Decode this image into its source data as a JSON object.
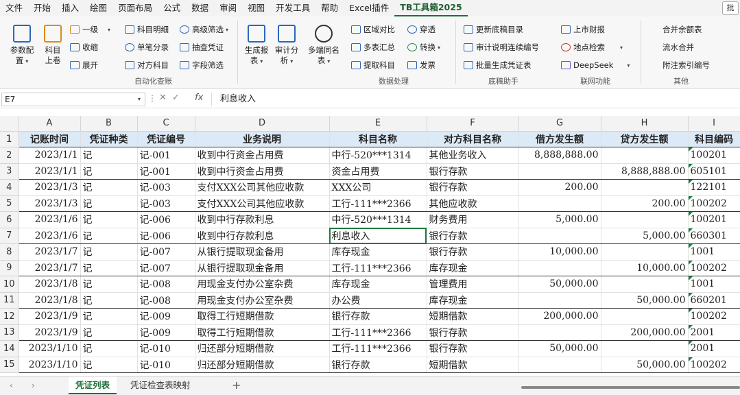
{
  "menu": [
    "文件",
    "开始",
    "插入",
    "绘图",
    "页面布局",
    "公式",
    "数据",
    "审阅",
    "视图",
    "开发工具",
    "帮助",
    "Excel插件",
    "TB工具箱2025"
  ],
  "menu_end": "批",
  "ribbon": {
    "g1": {
      "big1": "参数配置",
      "big2": "科目上卷",
      "small": [
        "一级",
        "收缩",
        "展开",
        "科目明细",
        "单笔分录",
        "对方科目",
        "高级筛选",
        "抽查凭证",
        "字段筛选"
      ],
      "label": "自动化查账"
    },
    "g2": {
      "big1": "生成报表",
      "big2": "审计分析",
      "big3": "多端同名表",
      "small": [
        "区域对比",
        "多表汇总",
        "提取科目",
        "穿透",
        "转换",
        "发票"
      ],
      "label": "数据处理"
    },
    "g3": {
      "small": [
        "更新底稿目录",
        "审计说明连续编号",
        "批量生成凭证表",
        "上市财报",
        "地点检索",
        "DeepSeek"
      ],
      "label": "底稿助手",
      "label2": "联网功能"
    },
    "g4": {
      "small": [
        "合并余额表",
        "流水合并",
        "附注索引编号"
      ],
      "label": "其他"
    }
  },
  "formula": {
    "cell": "E7",
    "value": "利息收入"
  },
  "columns": [
    "A",
    "B",
    "C",
    "D",
    "E",
    "F",
    "G",
    "H",
    "I"
  ],
  "header_row": [
    "记账时间",
    "凭证种类",
    "凭证编号",
    "业务说明",
    "科目名称",
    "对方科目名称",
    "借方发生额",
    "贷方发生额",
    "科目编码"
  ],
  "rows": [
    [
      "2023/1/1",
      "记",
      "记-001",
      "收到中行资金占用费",
      "中行-520***1314",
      "其他业务收入",
      "8,888,888.00",
      "",
      "100201"
    ],
    [
      "2023/1/1",
      "记",
      "记-001",
      "收到中行资金占用费",
      "资金占用费",
      "银行存款",
      "",
      "8,888,888.00",
      "605101"
    ],
    [
      "2023/1/3",
      "记",
      "记-003",
      "支付XXX公司其他应收款",
      "XXX公司",
      "银行存款",
      "200.00",
      "",
      "122101"
    ],
    [
      "2023/1/3",
      "记",
      "记-003",
      "支付XXX公司其他应收款",
      "工行-111***2366",
      "其他应收款",
      "",
      "200.00",
      "100202"
    ],
    [
      "2023/1/6",
      "记",
      "记-006",
      "收到中行存款利息",
      "中行-520***1314",
      "财务费用",
      "5,000.00",
      "",
      "100201"
    ],
    [
      "2023/1/6",
      "记",
      "记-006",
      "收到中行存款利息",
      "利息收入",
      "银行存款",
      "",
      "5,000.00",
      "660301"
    ],
    [
      "2023/1/7",
      "记",
      "记-007",
      "从银行提取现金备用",
      "库存现金",
      "银行存款",
      "10,000.00",
      "",
      "1001"
    ],
    [
      "2023/1/7",
      "记",
      "记-007",
      "从银行提取现金备用",
      "工行-111***2366",
      "库存现金",
      "",
      "10,000.00",
      "100202"
    ],
    [
      "2023/1/8",
      "记",
      "记-008",
      "用现金支付办公室杂费",
      "库存现金",
      "管理费用",
      "50,000.00",
      "",
      "1001"
    ],
    [
      "2023/1/8",
      "记",
      "记-008",
      "用现金支付办公室杂费",
      "办公费",
      "库存现金",
      "",
      "50,000.00",
      "660201"
    ],
    [
      "2023/1/9",
      "记",
      "记-009",
      "取得工行短期借款",
      "银行存款",
      "短期借款",
      "200,000.00",
      "",
      "100202"
    ],
    [
      "2023/1/9",
      "记",
      "记-009",
      "取得工行短期借款",
      "工行-111***2366",
      "银行存款",
      "",
      "200,000.00",
      "2001"
    ],
    [
      "2023/1/10",
      "记",
      "记-010",
      "归还部分短期借款",
      "工行-111***2366",
      "银行存款",
      "50,000.00",
      "",
      "2001"
    ],
    [
      "2023/1/10",
      "记",
      "记-010",
      "归还部分短期借款",
      "银行存款",
      "短期借款",
      "",
      "50,000.00",
      "100202"
    ]
  ],
  "sheets": [
    "凭证列表",
    "凭证检查表映射"
  ],
  "colors": {
    "accent": "#1e6f3a",
    "header_fill": "#dce9f6"
  }
}
